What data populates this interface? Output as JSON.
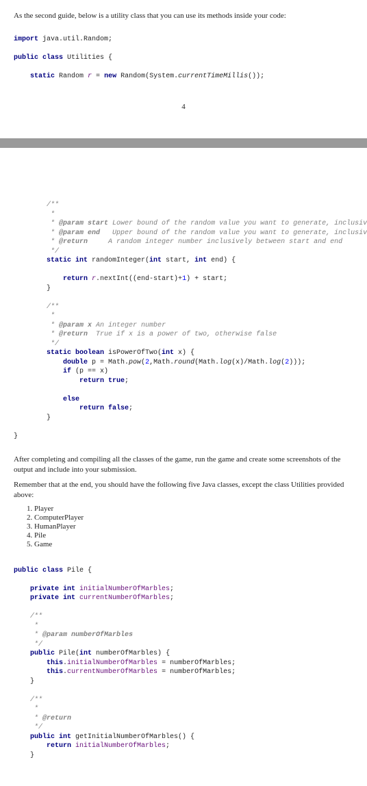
{
  "intro1": "As the second guide, below is a utility class that you can use its methods inside your code:",
  "code1": {
    "l1a": "import ",
    "l1b": "java.util.Random;",
    "l2a": "public class ",
    "l2b": "Utilities {",
    "l3a": "static ",
    "l3b": "Random ",
    "l3c": "r ",
    "l3d": "= ",
    "l3e": "new ",
    "l3f": "Random(System.",
    "l3g": "currentTimeMillis",
    "l3h": "());"
  },
  "pageNum": "4",
  "code2": {
    "c1": "/**",
    "c2": " *",
    "c3a": " * ",
    "c3b": "@param ",
    "c3c": "start ",
    "c3d": "Lower bound of the random value you want to generate, inclusive.",
    "c4a": " * ",
    "c4b": "@param ",
    "c4c": "end   ",
    "c4d": "Upper bound of the random value you want to generate, inclusive.",
    "c5a": " * ",
    "c5b": "@return     ",
    "c5d": "A random integer number inclusively between start and end",
    "c6": " */",
    "m1a": "static int ",
    "m1b": "randomInteger(",
    "m1c": "int ",
    "m1d": "start, ",
    "m1e": "int ",
    "m1f": "end) {",
    "m2a": "return ",
    "m2b": "r",
    "m2c": ".nextInt((end-start)+",
    "m2d": "1",
    "m2e": ") + start;",
    "m3": "}",
    "d1": "/**",
    "d2": " *",
    "d3a": " * ",
    "d3b": "@param ",
    "d3c": "x ",
    "d3d": "An integer number",
    "d4a": " * ",
    "d4b": "@return  ",
    "d4d": "True if x is a power of two, otherwise false",
    "d5": " */",
    "n1a": "static boolean ",
    "n1b": "isPowerOfTwo(",
    "n1c": "int ",
    "n1d": "x) {",
    "n2a": "double ",
    "n2b": "p = Math.",
    "n2c": "pow",
    "n2d": "(",
    "n2e": "2",
    "n2f": ",Math.",
    "n2g": "round",
    "n2h": "(Math.",
    "n2i": "log",
    "n2j": "(x)/Math.",
    "n2k": "log",
    "n2l": "(",
    "n2m": "2",
    "n2n": ")));",
    "n3a": "if ",
    "n3b": "(p == x)",
    "n4a": "return true",
    "n4b": ";",
    "n5": "else",
    "n6a": "return false",
    "n6b": ";",
    "n7": "}",
    "end": "}"
  },
  "after1": "After completing and compiling all the classes of the game, run the game and create some screenshots of the output and include into your submission.",
  "after2": "Remember that at the end, you should have the following five Java classes, except the class Utilities provided above:",
  "classes": [
    "Player",
    "ComputerPlayer",
    "HumanPlayer",
    "Pile",
    "Game"
  ],
  "pile": {
    "h1a": "public class ",
    "h1b": "Pile {",
    "f1a": "private int ",
    "f1b": "initialNumberOfMarbles",
    "f1c": ";",
    "f2a": "private int ",
    "f2b": "currentNumberOfMarbles",
    "f2c": ";",
    "c1": "/**",
    "c2": " *",
    "c3a": " * ",
    "c3b": "@param ",
    "c3c": "numberOfMarbles",
    "c4": " */",
    "m1a": "public ",
    "m1b": "Pile(",
    "m1c": "int ",
    "m1d": "numberOfMarbles) {",
    "m2a": "this",
    "m2b": ".",
    "m2c": "initialNumberOfMarbles ",
    "m2d": "= numberOfMarbles;",
    "m3a": "this",
    "m3b": ".",
    "m3c": "currentNumberOfMarbles ",
    "m3d": "= numberOfMarbles;",
    "m4": "}",
    "d1": "/**",
    "d2": " *",
    "d3a": " * ",
    "d3b": "@return",
    "d4": " */",
    "g1a": "public int ",
    "g1b": "getInitialNumberOfMarbles() {",
    "g2a": "return ",
    "g2b": "initialNumberOfMarbles",
    "g2c": ";",
    "g3": "}"
  }
}
